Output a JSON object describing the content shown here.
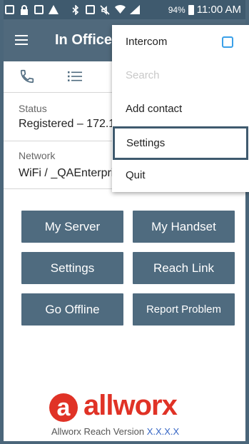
{
  "statusbar": {
    "icons": [
      "keyboard-icon",
      "lock-icon",
      "image-icon",
      "warning-icon",
      "bluetooth-icon",
      "nfc-icon",
      "mute-icon",
      "wifi-icon",
      "signal-icon"
    ],
    "battery": "94%",
    "time": "11:00 AM"
  },
  "appbar": {
    "title": "In Office"
  },
  "status": {
    "label": "Status",
    "value": "Registered – 172.1"
  },
  "network": {
    "label": "Network",
    "value": "WiFi / _QAEnterpri"
  },
  "buttons": {
    "my_server": "My Server",
    "my_handset": "My Handset",
    "settings": "Settings",
    "reach_link": "Reach Link",
    "go_offline": "Go Offline",
    "report_problem": "Report Problem"
  },
  "footer": {
    "logo_letter": "a",
    "logo_text": "allworx",
    "version_label": "Allworx Reach Version",
    "version_number": "X.X.X.X"
  },
  "menu": {
    "intercom": "Intercom",
    "intercom_checked": false,
    "search": "Search",
    "add_contact": "Add contact",
    "settings": "Settings",
    "quit": "Quit"
  },
  "colors": {
    "appbar": "#50697c",
    "button": "#4f6b7f",
    "brand_red": "#e03226",
    "checkbox": "#3aa0e8",
    "version_link": "#3565c4"
  }
}
